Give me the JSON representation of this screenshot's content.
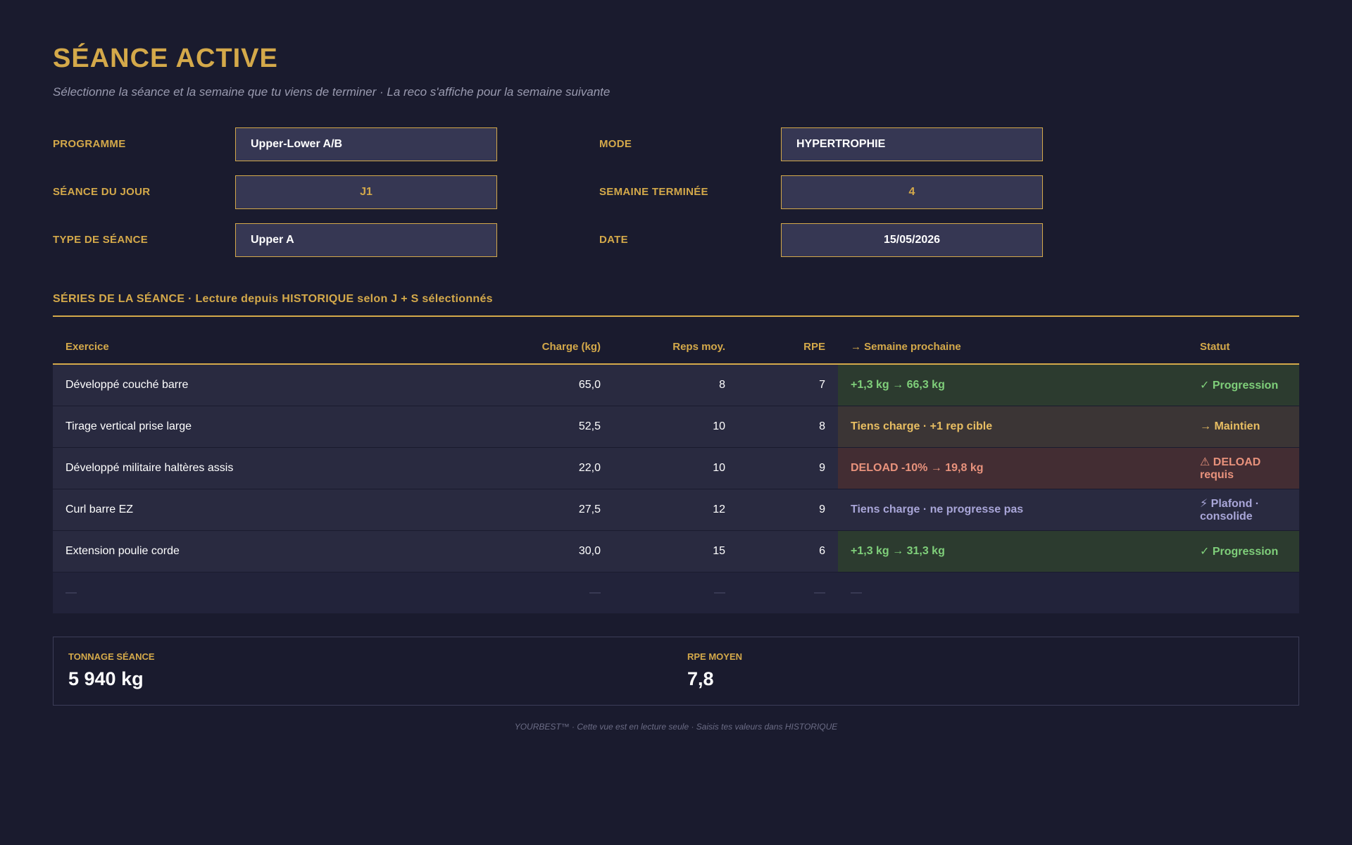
{
  "page": {
    "title": "SÉANCE ACTIVE",
    "subtitle": "Sélectionne la séance et la semaine que tu viens de terminer · La reco s'affiche pour la semaine suivante"
  },
  "fields": {
    "programme": {
      "label": "PROGRAMME",
      "value": "Upper-Lower A/B"
    },
    "seance_jour": {
      "label": "SÉANCE DU JOUR",
      "value": "J1"
    },
    "type_seance": {
      "label": "TYPE DE SÉANCE",
      "value": "Upper A"
    },
    "mode": {
      "label": "MODE",
      "value": "HYPERTROPHIE"
    },
    "semaine_terminee": {
      "label": "SEMAINE TERMINÉE",
      "value": "4"
    },
    "date": {
      "label": "DATE",
      "value": "15/05/2026"
    }
  },
  "section": {
    "title": "SÉRIES DE LA SÉANCE · Lecture depuis HISTORIQUE selon J + S sélectionnés"
  },
  "table": {
    "headers": {
      "exercice": "Exercice",
      "charge": "Charge (kg)",
      "reps": "Reps moy.",
      "rpe": "RPE",
      "reco": "→ Semaine prochaine",
      "statut": "Statut"
    },
    "rows": [
      {
        "exercice": "Développé couché barre",
        "charge": "65,0",
        "reps": "8",
        "rpe": "7",
        "reco": "+1,3 kg → 66,3 kg",
        "statut": "✓ Progression",
        "tone": "green"
      },
      {
        "exercice": "Tirage vertical prise large",
        "charge": "52,5",
        "reps": "10",
        "rpe": "8",
        "reco": "Tiens charge · +1 rep cible",
        "statut": "→ Maintien",
        "tone": "amber"
      },
      {
        "exercice": "Développé militaire haltères assis",
        "charge": "22,0",
        "reps": "10",
        "rpe": "9",
        "reco": "DELOAD -10% → 19,8 kg",
        "statut": "⚠ DELOAD requis",
        "tone": "red"
      },
      {
        "exercice": "Curl barre EZ",
        "charge": "27,5",
        "reps": "12",
        "rpe": "9",
        "reco": "Tiens charge · ne progresse pas",
        "statut": "⚡ Plafond · consolide",
        "tone": "violet"
      },
      {
        "exercice": "Extension poulie corde",
        "charge": "30,0",
        "reps": "15",
        "rpe": "6",
        "reco": "+1,3 kg → 31,3 kg",
        "statut": "✓ Progression",
        "tone": "green"
      },
      {
        "exercice": "—",
        "charge": "—",
        "reps": "—",
        "rpe": "—",
        "reco": "—",
        "statut": "",
        "tone": "empty"
      }
    ]
  },
  "summary": {
    "tonnage": {
      "label": "TONNAGE SÉANCE",
      "value": "5 940 kg"
    },
    "rpe_moyen": {
      "label": "RPE MOYEN",
      "value": "7,8"
    }
  },
  "footer": {
    "text": "YOURBEST™ · Cette vue est en lecture seule · Saisis tes valeurs dans HISTORIQUE"
  },
  "colors": {
    "background": "#1a1b2e",
    "accent_gold": "#d4a94a",
    "progression_green": "#7fcf7a",
    "maintien_amber": "#e8be62",
    "deload_red": "#e8927c",
    "plafond_violet": "#a9a6d8"
  }
}
